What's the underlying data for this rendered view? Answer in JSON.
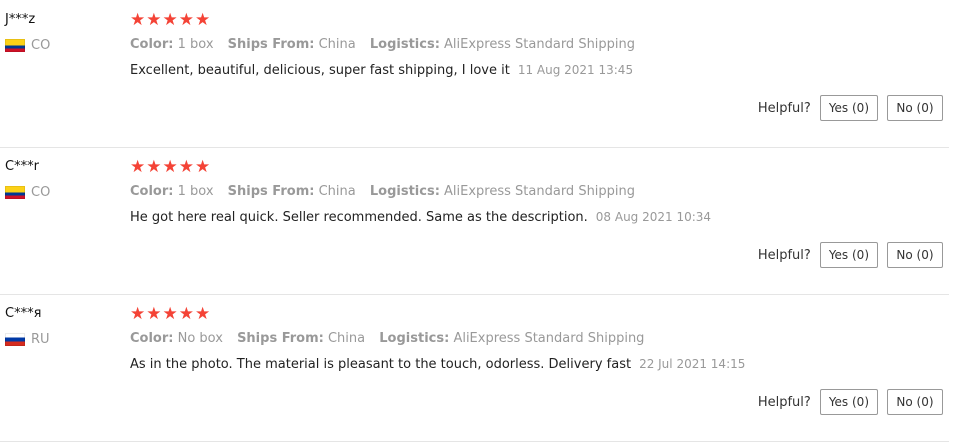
{
  "labels": {
    "color": "Color:",
    "ships_from": "Ships From:",
    "logistics": "Logistics:",
    "helpful": "Helpful?"
  },
  "reviews": [
    {
      "user": "J***z",
      "country": "CO",
      "flag": "co",
      "stars": "★★★★★",
      "rating": 5,
      "color": "1 box",
      "ships_from": "China",
      "logistics": "AliExpress Standard Shipping",
      "text": "Excellent, beautiful, delicious, super fast shipping, I love it",
      "date": "11 Aug 2021 13:45",
      "yes": "Yes (0)",
      "no": "No (0)"
    },
    {
      "user": "C***r",
      "country": "CO",
      "flag": "co",
      "stars": "★★★★★",
      "rating": 5,
      "color": "1 box",
      "ships_from": "China",
      "logistics": "AliExpress Standard Shipping",
      "text": "He got here real quick. Seller recommended. Same as the description.",
      "date": "08 Aug 2021 10:34",
      "yes": "Yes (0)",
      "no": "No (0)"
    },
    {
      "user": "C***я",
      "country": "RU",
      "flag": "ru",
      "stars": "★★★★★",
      "rating": 5,
      "color": "No box",
      "ships_from": "China",
      "logistics": "AliExpress Standard Shipping",
      "text": "As in the photo. The material is pleasant to the touch, odorless. Delivery fast",
      "date": "22 Jul 2021 14:15",
      "yes": "Yes (0)",
      "no": "No (0)"
    }
  ]
}
